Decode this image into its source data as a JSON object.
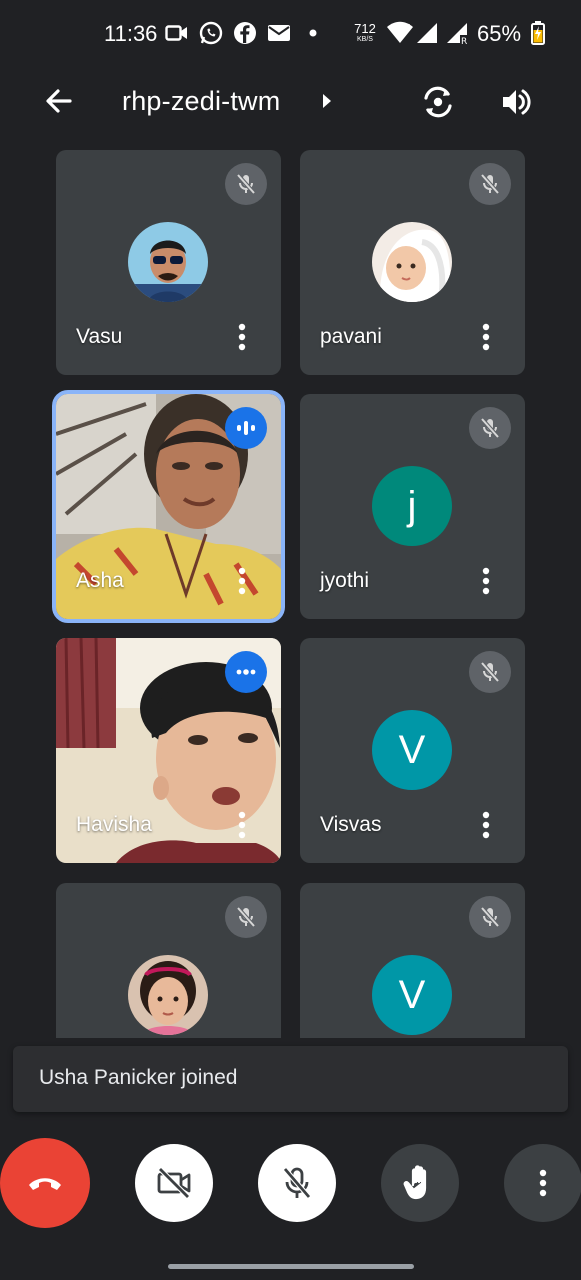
{
  "status_bar": {
    "time": "11:36",
    "net_speed_value": "712",
    "net_speed_unit": "KB/S",
    "battery_percent": "65%",
    "icons": [
      "video-call-icon",
      "whatsapp-icon",
      "facebook-icon",
      "mail-icon",
      "dot-icon",
      "wifi-icon",
      "signal-icon",
      "signal-roaming-icon",
      "battery-charging-icon"
    ]
  },
  "header": {
    "meeting_code": "rhp-zedi-twm",
    "icons": [
      "back-arrow-icon",
      "chevron-right-icon",
      "switch-camera-icon",
      "speaker-icon"
    ]
  },
  "participants": [
    {
      "name": "Vasu",
      "mic": "muted",
      "avatar": "photo"
    },
    {
      "name": "pavani",
      "mic": "muted",
      "avatar": "photo"
    },
    {
      "name": "Asha",
      "mic": "speaking",
      "avatar": "video",
      "active": true
    },
    {
      "name": "jyothi",
      "mic": "muted",
      "avatar": "letter",
      "letter": "j",
      "color": "#00897b"
    },
    {
      "name": "Havisha",
      "mic": "speaking",
      "avatar": "video"
    },
    {
      "name": "Visvas",
      "mic": "muted",
      "avatar": "letter",
      "letter": "V",
      "color": "#0097a7"
    },
    {
      "name": "",
      "mic": "muted",
      "avatar": "photo"
    },
    {
      "name": "",
      "mic": "muted",
      "avatar": "letter",
      "letter": "V",
      "color": "#0097a7"
    }
  ],
  "toast": {
    "message": "Usha Panicker joined"
  },
  "controls": {
    "icons": [
      "end-call-icon",
      "camera-off-icon",
      "mic-off-icon",
      "raise-hand-icon",
      "more-vertical-icon"
    ],
    "end_call_color": "#ea4335"
  },
  "colors": {
    "background": "#202124",
    "tile": "#3c4043",
    "active_outline": "#8ab4f8",
    "speaking_badge": "#1a73e8"
  }
}
